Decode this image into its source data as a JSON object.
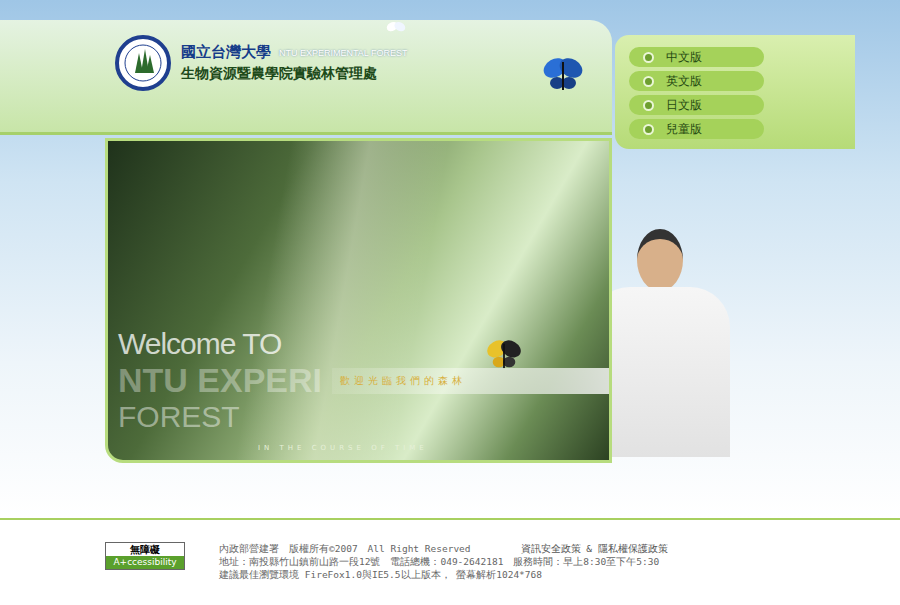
{
  "logo": {
    "title": "國立台灣大學",
    "subtitle_en": "NTU EXPERIMENTAL FOREST",
    "subtitle": "生物資源暨農學院實驗林管理處"
  },
  "languages": [
    {
      "label": "中文版"
    },
    {
      "label": "英文版"
    },
    {
      "label": "日文版"
    },
    {
      "label": "兒童版"
    }
  ],
  "banner": {
    "welcome": "Welcome TO",
    "name": "NTU EXPERI",
    "forest": "FOREST",
    "tagline": "歡迎光臨我們的森林",
    "caption": "IN THE COURSE OF TIME"
  },
  "footer": {
    "badge_top": "無障礙",
    "badge_bottom": "A+ccessibility",
    "copyright": "內政部營建署　版權所有©2007　All Right Reserved",
    "policy": "資訊安全政策 & 隱私權保護政策",
    "address": "地址：南投縣竹山鎮前山路一段12號　電話總機：049-2642181　服務時間：早上8:30至下午5:30",
    "recommend": "建議最佳瀏覽環境 FireFox1.0與IE5.5以上版本， 螢幕解析1024*768"
  }
}
